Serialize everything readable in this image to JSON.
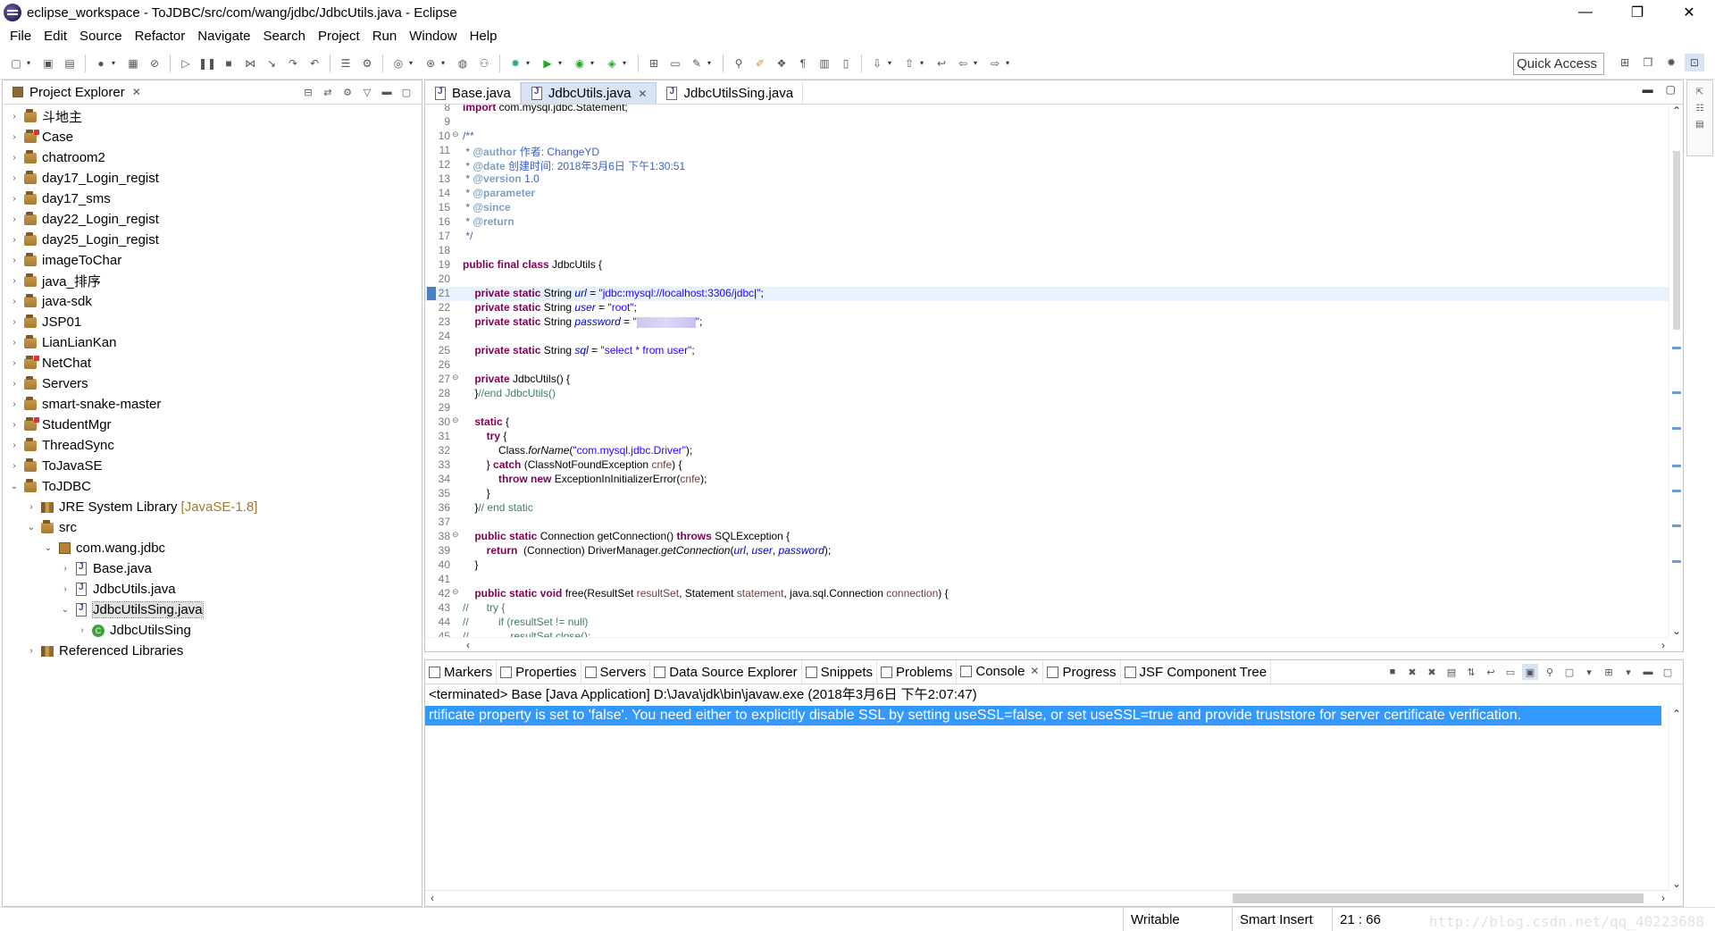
{
  "window": {
    "title": "eclipse_workspace - ToJDBC/src/com/wang/jdbc/JdbcUtils.java - Eclipse",
    "minimize": "—",
    "restore": "❐",
    "close": "✕"
  },
  "menu": [
    "File",
    "Edit",
    "Source",
    "Refactor",
    "Navigate",
    "Search",
    "Project",
    "Run",
    "Window",
    "Help"
  ],
  "toolbar": {
    "quick_access": "Quick Access"
  },
  "explorer": {
    "title": "Project Explorer",
    "items": [
      {
        "label": "斗地主",
        "indent": 0,
        "twisty": "›",
        "icon": "project"
      },
      {
        "label": "Case",
        "indent": 0,
        "twisty": "›",
        "icon": "project-red"
      },
      {
        "label": "chatroom2",
        "indent": 0,
        "twisty": "›",
        "icon": "project"
      },
      {
        "label": "day17_Login_regist",
        "indent": 0,
        "twisty": "›",
        "icon": "project"
      },
      {
        "label": "day17_sms",
        "indent": 0,
        "twisty": "›",
        "icon": "project"
      },
      {
        "label": "day22_Login_regist",
        "indent": 0,
        "twisty": "›",
        "icon": "project"
      },
      {
        "label": "day25_Login_regist",
        "indent": 0,
        "twisty": "›",
        "icon": "project"
      },
      {
        "label": "imageToChar",
        "indent": 0,
        "twisty": "›",
        "icon": "project"
      },
      {
        "label": "java_排序",
        "indent": 0,
        "twisty": "›",
        "icon": "project"
      },
      {
        "label": "java-sdk",
        "indent": 0,
        "twisty": "›",
        "icon": "project"
      },
      {
        "label": "JSP01",
        "indent": 0,
        "twisty": "›",
        "icon": "project"
      },
      {
        "label": "LianLianKan",
        "indent": 0,
        "twisty": "›",
        "icon": "project"
      },
      {
        "label": "NetChat",
        "indent": 0,
        "twisty": "›",
        "icon": "project-red"
      },
      {
        "label": "Servers",
        "indent": 0,
        "twisty": "›",
        "icon": "project"
      },
      {
        "label": "smart-snake-master",
        "indent": 0,
        "twisty": "›",
        "icon": "project"
      },
      {
        "label": "StudentMgr",
        "indent": 0,
        "twisty": "›",
        "icon": "project-red"
      },
      {
        "label": "ThreadSync",
        "indent": 0,
        "twisty": "›",
        "icon": "project"
      },
      {
        "label": "ToJavaSE",
        "indent": 0,
        "twisty": "›",
        "icon": "project"
      },
      {
        "label": "ToJDBC",
        "indent": 0,
        "twisty": "⌄",
        "icon": "project"
      },
      {
        "label": "JRE System Library",
        "deco": "[JavaSE-1.8]",
        "indent": 1,
        "twisty": "›",
        "icon": "library"
      },
      {
        "label": "src",
        "indent": 1,
        "twisty": "⌄",
        "icon": "package-root"
      },
      {
        "label": "com.wang.jdbc",
        "indent": 2,
        "twisty": "⌄",
        "icon": "package"
      },
      {
        "label": "Base.java",
        "indent": 3,
        "twisty": "›",
        "icon": "java-file"
      },
      {
        "label": "JdbcUtils.java",
        "indent": 3,
        "twisty": "›",
        "icon": "java-file"
      },
      {
        "label": "JdbcUtilsSing.java",
        "indent": 3,
        "twisty": "⌄",
        "icon": "java-file",
        "selected": true
      },
      {
        "label": "JdbcUtilsSing",
        "indent": 4,
        "twisty": "›",
        "icon": "class"
      },
      {
        "label": "Referenced Libraries",
        "indent": 1,
        "twisty": "›",
        "icon": "library"
      }
    ]
  },
  "editor": {
    "tabs": [
      {
        "label": "Base.java",
        "active": false
      },
      {
        "label": "JdbcUtils.java",
        "active": true,
        "close": "✕"
      },
      {
        "label": "JdbcUtilsSing.java",
        "active": false
      }
    ],
    "current_line": 21,
    "lines": [
      {
        "n": "8",
        "fold": "",
        "html": "<span class='kw'>import</span> com.mysql.jdbc.Statement;"
      },
      {
        "n": "9",
        "fold": "",
        "html": ""
      },
      {
        "n": "10",
        "fold": "⊖",
        "html": "<span class='cm'>/**</span>"
      },
      {
        "n": "11",
        "fold": "",
        "html": "<span class='cm'> * </span><span class='tag'>@author</span><span class='cm'> 作者: ChangeYD</span>"
      },
      {
        "n": "12",
        "fold": "",
        "html": "<span class='cm'> * </span><span class='tag'>@date</span><span class='cm'> 创建时间: 2018年3月6日 下午1:30:51</span>"
      },
      {
        "n": "13",
        "fold": "",
        "html": "<span class='cm'> * </span><span class='tag'>@version</span><span class='cm'> 1.0</span>"
      },
      {
        "n": "14",
        "fold": "",
        "html": "<span class='cm'> * </span><span class='tag'>@parameter</span>"
      },
      {
        "n": "15",
        "fold": "",
        "html": "<span class='cm'> * </span><span class='tag'>@since</span>"
      },
      {
        "n": "16",
        "fold": "",
        "html": "<span class='cm'> * </span><span class='tag'>@return</span>"
      },
      {
        "n": "17",
        "fold": "",
        "html": "<span class='cm'> */</span>"
      },
      {
        "n": "18",
        "fold": "",
        "html": ""
      },
      {
        "n": "19",
        "fold": "",
        "html": "<span class='kw'>public final class</span> JdbcUtils {"
      },
      {
        "n": "20",
        "fold": "",
        "html": ""
      },
      {
        "n": "21",
        "fold": "",
        "html": "    <span class='kw'>private static</span> String <span class='fld'>url</span> = <span class='str'>\"jdbc:mysql://localhost:3306/jdbc</span>|<span class='str'>\"</span>;"
      },
      {
        "n": "22",
        "fold": "",
        "html": "    <span class='kw'>private static</span> String <span class='fld'>user</span> = <span class='str'>\"root\"</span>;"
      },
      {
        "n": "23",
        "fold": "",
        "html": "    <span class='kw'>private static</span> String <span class='fld'>password</span> = <span class='str'>\"<span class='blur'></span>\"</span>;"
      },
      {
        "n": "24",
        "fold": "",
        "html": ""
      },
      {
        "n": "25",
        "fold": "",
        "html": "    <span class='kw'>private static</span> String <span class='fld'>sql</span> = <span class='str'>\"select * from user\"</span>;"
      },
      {
        "n": "26",
        "fold": "",
        "html": ""
      },
      {
        "n": "27",
        "fold": "⊖",
        "html": "    <span class='kw'>private</span> JdbcUtils() {"
      },
      {
        "n": "28",
        "fold": "",
        "html": "    }<span class='cmt'>//end JdbcUtils()</span>"
      },
      {
        "n": "29",
        "fold": "",
        "html": ""
      },
      {
        "n": "30",
        "fold": "⊖",
        "html": "    <span class='kw'>static</span> {"
      },
      {
        "n": "31",
        "fold": "",
        "html": "        <span class='kw'>try</span> {"
      },
      {
        "n": "32",
        "fold": "",
        "html": "            Class.<span class='ital'>forName</span>(<span class='str'>\"com.mysql.jdbc.Driver\"</span>);"
      },
      {
        "n": "33",
        "fold": "",
        "html": "        } <span class='kw'>catch</span> (ClassNotFoundException <span class='prm'>cnfe</span>) {"
      },
      {
        "n": "34",
        "fold": "",
        "html": "            <span class='kw'>throw new</span> ExceptionInInitializerError(<span class='prm'>cnfe</span>);"
      },
      {
        "n": "35",
        "fold": "",
        "html": "        }"
      },
      {
        "n": "36",
        "fold": "",
        "html": "    }<span class='cmt'>// end static</span>"
      },
      {
        "n": "37",
        "fold": "",
        "html": ""
      },
      {
        "n": "38",
        "fold": "⊖",
        "html": "    <span class='kw'>public static</span> Connection getConnection() <span class='kw'>throws</span> SQLException {"
      },
      {
        "n": "39",
        "fold": "",
        "html": "        <span class='kw'>return</span>  (Connection) DriverManager.<span class='ital'>getConnection</span>(<span class='fld'>url</span>, <span class='fld'>user</span>, <span class='fld'>password</span>);"
      },
      {
        "n": "40",
        "fold": "",
        "html": "    }"
      },
      {
        "n": "41",
        "fold": "",
        "html": ""
      },
      {
        "n": "42",
        "fold": "⊖",
        "html": "    <span class='kw'>public static void</span> free(ResultSet <span class='prm'>resultSet</span>, Statement <span class='prm'>statement</span>, java.sql.Connection <span class='prm'>connection</span>) {"
      },
      {
        "n": "43",
        "fold": "",
        "html": "<span class='cmt'>//      try {</span>"
      },
      {
        "n": "44",
        "fold": "",
        "html": "<span class='cmt'>//          if (resultSet != null)</span>"
      },
      {
        "n": "45",
        "fold": "",
        "html": "<span class='cmt'>//              resultSet.close();</span>"
      }
    ]
  },
  "console": {
    "tabs": [
      {
        "label": "Markers"
      },
      {
        "label": "Properties"
      },
      {
        "label": "Servers"
      },
      {
        "label": "Data Source Explorer"
      },
      {
        "label": "Snippets"
      },
      {
        "label": "Problems"
      },
      {
        "label": "Console",
        "active": true
      },
      {
        "label": "Progress"
      },
      {
        "label": "JSF Component Tree"
      }
    ],
    "header": "<terminated> Base [Java Application] D:\\Java\\jdk\\bin\\javaw.exe (2018年3月6日 下午2:07:47)",
    "error_line": "rtificate property is set to 'false'. You need either to explicitly disable SSL by setting useSSL=false, or set useSSL=true and provide truststore for server certificate verification."
  },
  "status": {
    "writable": "Writable",
    "insert_mode": "Smart Insert",
    "position": "21 : 66",
    "watermark": "http://blog.csdn.net/qq_40223688"
  }
}
